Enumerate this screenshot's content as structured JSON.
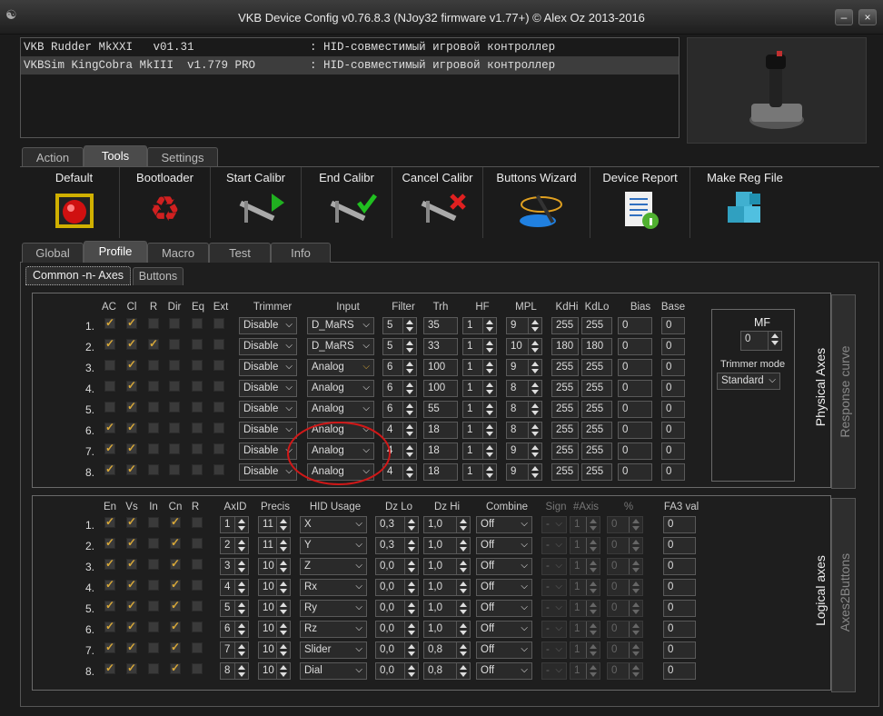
{
  "window": {
    "title": "VKB Device Config v0.76.8.3 (NJoy32 firmware v1.77+) © Alex Oz 2013-2016"
  },
  "devices": [
    {
      "text": "VKB Rudder MkXXI   v01.31                 : HID-совместимый игровой контроллер"
    },
    {
      "text": "VKBSim KingCobra MkIII  v1.779 PRO        : HID-совместимый игровой контроллер"
    }
  ],
  "main_tabs": [
    {
      "label": "Action"
    },
    {
      "label": "Tools"
    },
    {
      "label": "Settings"
    }
  ],
  "tools": [
    {
      "label": "Default"
    },
    {
      "label": "Bootloader"
    },
    {
      "label": "Start Calibr"
    },
    {
      "label": "End Calibr"
    },
    {
      "label": "Cancel Calibr"
    },
    {
      "label": "Buttons Wizard"
    },
    {
      "label": "Device Report"
    },
    {
      "label": "Make Reg File"
    }
  ],
  "sub_tabs": [
    {
      "label": "Global"
    },
    {
      "label": "Profile"
    },
    {
      "label": "Macro"
    },
    {
      "label": "Test"
    },
    {
      "label": "Info"
    }
  ],
  "profile_tabs": [
    {
      "label": "Common -n- Axes"
    },
    {
      "label": "Buttons"
    }
  ],
  "physical": {
    "headers": {
      "ac": "AC",
      "cl": "Cl",
      "r": "R",
      "dir": "Dir",
      "eq": "Eq",
      "ext": "Ext",
      "trimmer": "Trimmer",
      "input": "Input",
      "filter": "Filter",
      "trh": "Trh",
      "hf": "HF",
      "mpl": "MPL",
      "kdhi": "KdHi",
      "kdlo": "KdLo",
      "bias": "Bias",
      "base": "Base"
    },
    "rows": [
      {
        "n": "1.",
        "ac": true,
        "cl": true,
        "r": false,
        "dir": false,
        "eq": false,
        "ext": false,
        "trimmer": "Disable",
        "input": "D_MaRS",
        "filter": "5",
        "trh": "35",
        "hf": "1",
        "mpl": "9",
        "kdhi": "255",
        "kdlo": "255",
        "bias": "0",
        "base": "0"
      },
      {
        "n": "2.",
        "ac": true,
        "cl": true,
        "r": true,
        "dir": false,
        "eq": false,
        "ext": false,
        "trimmer": "Disable",
        "input": "D_MaRS",
        "filter": "5",
        "trh": "33",
        "hf": "1",
        "mpl": "10",
        "kdhi": "180",
        "kdlo": "180",
        "bias": "0",
        "base": "0"
      },
      {
        "n": "3.",
        "ac": false,
        "cl": true,
        "r": false,
        "dir": false,
        "eq": false,
        "ext": false,
        "trimmer": "Disable",
        "input": "Analog",
        "filter": "6",
        "trh": "100",
        "hf": "1",
        "mpl": "9",
        "kdhi": "255",
        "kdlo": "255",
        "bias": "0",
        "base": "0"
      },
      {
        "n": "4.",
        "ac": false,
        "cl": true,
        "r": false,
        "dir": false,
        "eq": false,
        "ext": false,
        "trimmer": "Disable",
        "input": "Analog",
        "filter": "6",
        "trh": "100",
        "hf": "1",
        "mpl": "8",
        "kdhi": "255",
        "kdlo": "255",
        "bias": "0",
        "base": "0"
      },
      {
        "n": "5.",
        "ac": false,
        "cl": true,
        "r": false,
        "dir": false,
        "eq": false,
        "ext": false,
        "trimmer": "Disable",
        "input": "Analog",
        "filter": "6",
        "trh": "55",
        "hf": "1",
        "mpl": "8",
        "kdhi": "255",
        "kdlo": "255",
        "bias": "0",
        "base": "0"
      },
      {
        "n": "6.",
        "ac": true,
        "cl": true,
        "r": false,
        "dir": false,
        "eq": false,
        "ext": false,
        "trimmer": "Disable",
        "input": "Analog",
        "filter": "4",
        "trh": "18",
        "hf": "1",
        "mpl": "8",
        "kdhi": "255",
        "kdlo": "255",
        "bias": "0",
        "base": "0"
      },
      {
        "n": "7.",
        "ac": true,
        "cl": true,
        "r": false,
        "dir": false,
        "eq": false,
        "ext": false,
        "trimmer": "Disable",
        "input": "Analog",
        "filter": "4",
        "trh": "18",
        "hf": "1",
        "mpl": "9",
        "kdhi": "255",
        "kdlo": "255",
        "bias": "0",
        "base": "0"
      },
      {
        "n": "8.",
        "ac": true,
        "cl": true,
        "r": false,
        "dir": false,
        "eq": false,
        "ext": false,
        "trimmer": "Disable",
        "input": "Analog",
        "filter": "4",
        "trh": "18",
        "hf": "1",
        "mpl": "9",
        "kdhi": "255",
        "kdlo": "255",
        "bias": "0",
        "base": "0"
      }
    ],
    "mf_label": "MF",
    "mf_value": "0",
    "trimmer_mode_label": "Trimmer mode",
    "trimmer_mode": "Standard",
    "side_tabs": {
      "physical": "Physical Axes",
      "curve": "Response curve"
    }
  },
  "logical": {
    "headers": {
      "en": "En",
      "vs": "Vs",
      "in": "In",
      "cn": "Cn",
      "r": "R",
      "axid": "AxID",
      "precis": "Precis",
      "hid": "HID Usage",
      "dzlo": "Dz Lo",
      "dzhi": "Dz Hi",
      "combine": "Combine",
      "sign": "Sign",
      "naxis": "#Axis",
      "pct": "%",
      "fa3": "FA3 val"
    },
    "rows": [
      {
        "n": "1.",
        "en": true,
        "vs": true,
        "in": false,
        "cn": true,
        "r": false,
        "axid": "1",
        "precis": "11",
        "hid": "X",
        "dzlo": "0,3",
        "dzhi": "1,0",
        "combine": "Off",
        "sign": "-",
        "naxis": "1",
        "pct": "0",
        "fa3": "0"
      },
      {
        "n": "2.",
        "en": true,
        "vs": true,
        "in": false,
        "cn": true,
        "r": false,
        "axid": "2",
        "precis": "11",
        "hid": "Y",
        "dzlo": "0,3",
        "dzhi": "1,0",
        "combine": "Off",
        "sign": "-",
        "naxis": "1",
        "pct": "0",
        "fa3": "0"
      },
      {
        "n": "3.",
        "en": true,
        "vs": true,
        "in": false,
        "cn": true,
        "r": false,
        "axid": "3",
        "precis": "10",
        "hid": "Z",
        "dzlo": "0,0",
        "dzhi": "1,0",
        "combine": "Off",
        "sign": "-",
        "naxis": "1",
        "pct": "0",
        "fa3": "0"
      },
      {
        "n": "4.",
        "en": true,
        "vs": true,
        "in": false,
        "cn": true,
        "r": false,
        "axid": "4",
        "precis": "10",
        "hid": "Rx",
        "dzlo": "0,0",
        "dzhi": "1,0",
        "combine": "Off",
        "sign": "-",
        "naxis": "1",
        "pct": "0",
        "fa3": "0"
      },
      {
        "n": "5.",
        "en": true,
        "vs": true,
        "in": false,
        "cn": true,
        "r": false,
        "axid": "5",
        "precis": "10",
        "hid": "Ry",
        "dzlo": "0,0",
        "dzhi": "1,0",
        "combine": "Off",
        "sign": "-",
        "naxis": "1",
        "pct": "0",
        "fa3": "0"
      },
      {
        "n": "6.",
        "en": true,
        "vs": true,
        "in": false,
        "cn": true,
        "r": false,
        "axid": "6",
        "precis": "10",
        "hid": "Rz",
        "dzlo": "0,0",
        "dzhi": "1,0",
        "combine": "Off",
        "sign": "-",
        "naxis": "1",
        "pct": "0",
        "fa3": "0"
      },
      {
        "n": "7.",
        "en": true,
        "vs": true,
        "in": false,
        "cn": true,
        "r": false,
        "axid": "7",
        "precis": "10",
        "hid": "Slider",
        "dzlo": "0,0",
        "dzhi": "0,8",
        "combine": "Off",
        "sign": "-",
        "naxis": "1",
        "pct": "0",
        "fa3": "0"
      },
      {
        "n": "8.",
        "en": true,
        "vs": true,
        "in": false,
        "cn": true,
        "r": false,
        "axid": "8",
        "precis": "10",
        "hid": "Dial",
        "dzlo": "0,0",
        "dzhi": "0,8",
        "combine": "Off",
        "sign": "-",
        "naxis": "1",
        "pct": "0",
        "fa3": "0"
      }
    ],
    "side_tabs": {
      "logical": "Logical axes",
      "a2b": "Axes2Buttons"
    }
  },
  "colors": {
    "checkmark": "#d8a838",
    "highlight_circle": "#d01818"
  }
}
